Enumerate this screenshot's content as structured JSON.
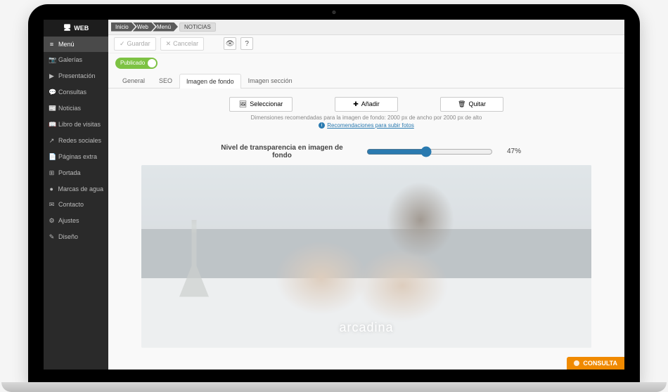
{
  "brand": "WEB",
  "sidebar": {
    "items": [
      {
        "icon": "≡",
        "label": "Menú",
        "active": true
      },
      {
        "icon": "📷",
        "label": "Galerías"
      },
      {
        "icon": "▶",
        "label": "Presentación"
      },
      {
        "icon": "💬",
        "label": "Consultas"
      },
      {
        "icon": "📰",
        "label": "Noticias"
      },
      {
        "icon": "📖",
        "label": "Libro de visitas"
      },
      {
        "icon": "↗",
        "label": "Redes sociales"
      },
      {
        "icon": "📄",
        "label": "Páginas extra"
      },
      {
        "icon": "⊞",
        "label": "Portada"
      },
      {
        "icon": "●",
        "label": "Marcas de agua"
      },
      {
        "icon": "✉",
        "label": "Contacto"
      },
      {
        "icon": "⚙",
        "label": "Ajustes"
      },
      {
        "icon": "✎",
        "label": "Diseño"
      }
    ]
  },
  "breadcrumbs": [
    "Inicio",
    "Web",
    "Menú",
    "NOTICIAS"
  ],
  "toolbar": {
    "save": "Guardar",
    "cancel": "Cancelar"
  },
  "publish_toggle": {
    "label": "Publicado",
    "on": true
  },
  "tabs": [
    "General",
    "SEO",
    "Imagen de fondo",
    "Imagen sección"
  ],
  "active_tab": 2,
  "image_actions": {
    "select": "Seleccionar",
    "add": "Añadir",
    "remove": "Quitar"
  },
  "dimensions_hint": "Dimensiones recomendadas para la imagen de fondo: 2000 px de ancho por 2000 px de alto",
  "recommendations_link": "Recomendaciones para subir fotos",
  "transparency": {
    "label": "Nivel de transparencia en imagen de fondo",
    "value": 47,
    "display": "47%"
  },
  "watermark": "arcadina",
  "consult_button": "CONSULTA"
}
